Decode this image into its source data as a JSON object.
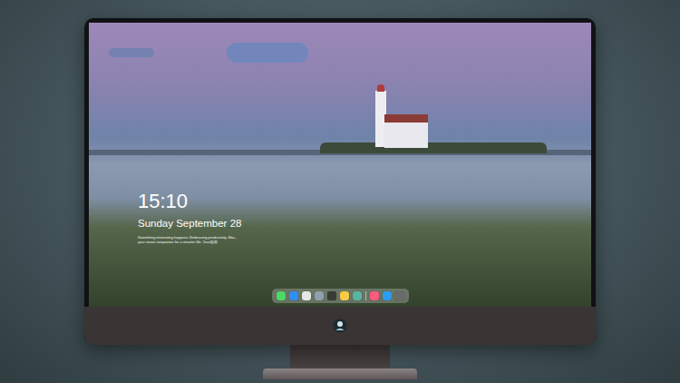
{
  "clock": {
    "time": "15:10",
    "date": "Sunday September 28",
    "caption": [
      "Something interesting happens. Embracing productivity. Mac,",
      "your smart companion for a smarter life. 2xxx版权"
    ]
  },
  "dock": {
    "items": [
      {
        "color": "#4cd964"
      },
      {
        "color": "#2f8ff0"
      },
      {
        "color": "#e6e6e6"
      },
      {
        "color": "#8fa0ae"
      },
      {
        "color": "#3a3a3a"
      },
      {
        "color": "#f7c948"
      },
      {
        "color": "#58b6a0"
      },
      {
        "color": "#fc5c7d"
      },
      {
        "color": "#2a9df4"
      },
      {
        "color": "#6b6b6b"
      }
    ]
  }
}
